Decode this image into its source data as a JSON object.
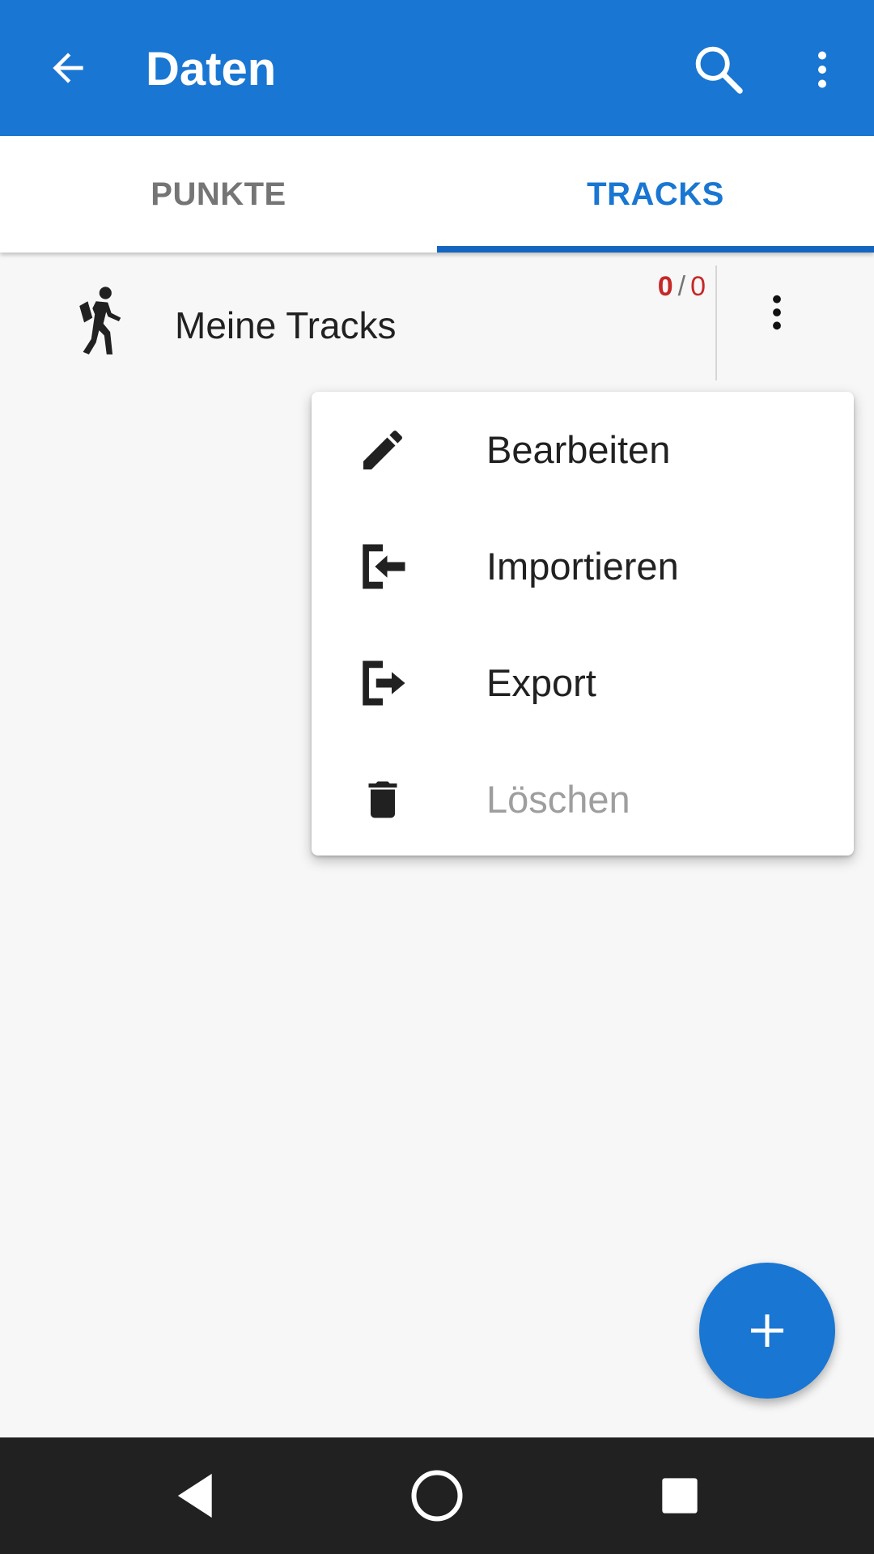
{
  "app_bar": {
    "title": "Daten",
    "back_icon": "arrow-back-icon",
    "search_icon": "search-icon",
    "overflow_icon": "more-vert-icon",
    "background": "#1976d2"
  },
  "tabs": [
    {
      "label": "PUNKTE",
      "selected": false
    },
    {
      "label": "TRACKS",
      "selected": true
    }
  ],
  "list": {
    "items": [
      {
        "icon": "hiker-icon",
        "label": "Meine Tracks",
        "count_visible": "0",
        "count_separator": "/",
        "count_total": "0",
        "more_icon": "more-vert-icon"
      }
    ]
  },
  "menu": {
    "items": [
      {
        "icon": "pencil-icon",
        "label": "Bearbeiten",
        "enabled": true
      },
      {
        "icon": "import-icon",
        "label": "Importieren",
        "enabled": true
      },
      {
        "icon": "export-icon",
        "label": "Export",
        "enabled": true
      },
      {
        "icon": "trash-icon",
        "label": "Löschen",
        "enabled": false
      }
    ]
  },
  "fab": {
    "icon": "plus-icon"
  },
  "navbar": {
    "back": "nav-back-icon",
    "home": "nav-home-icon",
    "recents": "nav-recents-icon"
  },
  "colors": {
    "primary": "#1976d2",
    "accent_red": "#c62828",
    "background": "#f7f7f7"
  }
}
